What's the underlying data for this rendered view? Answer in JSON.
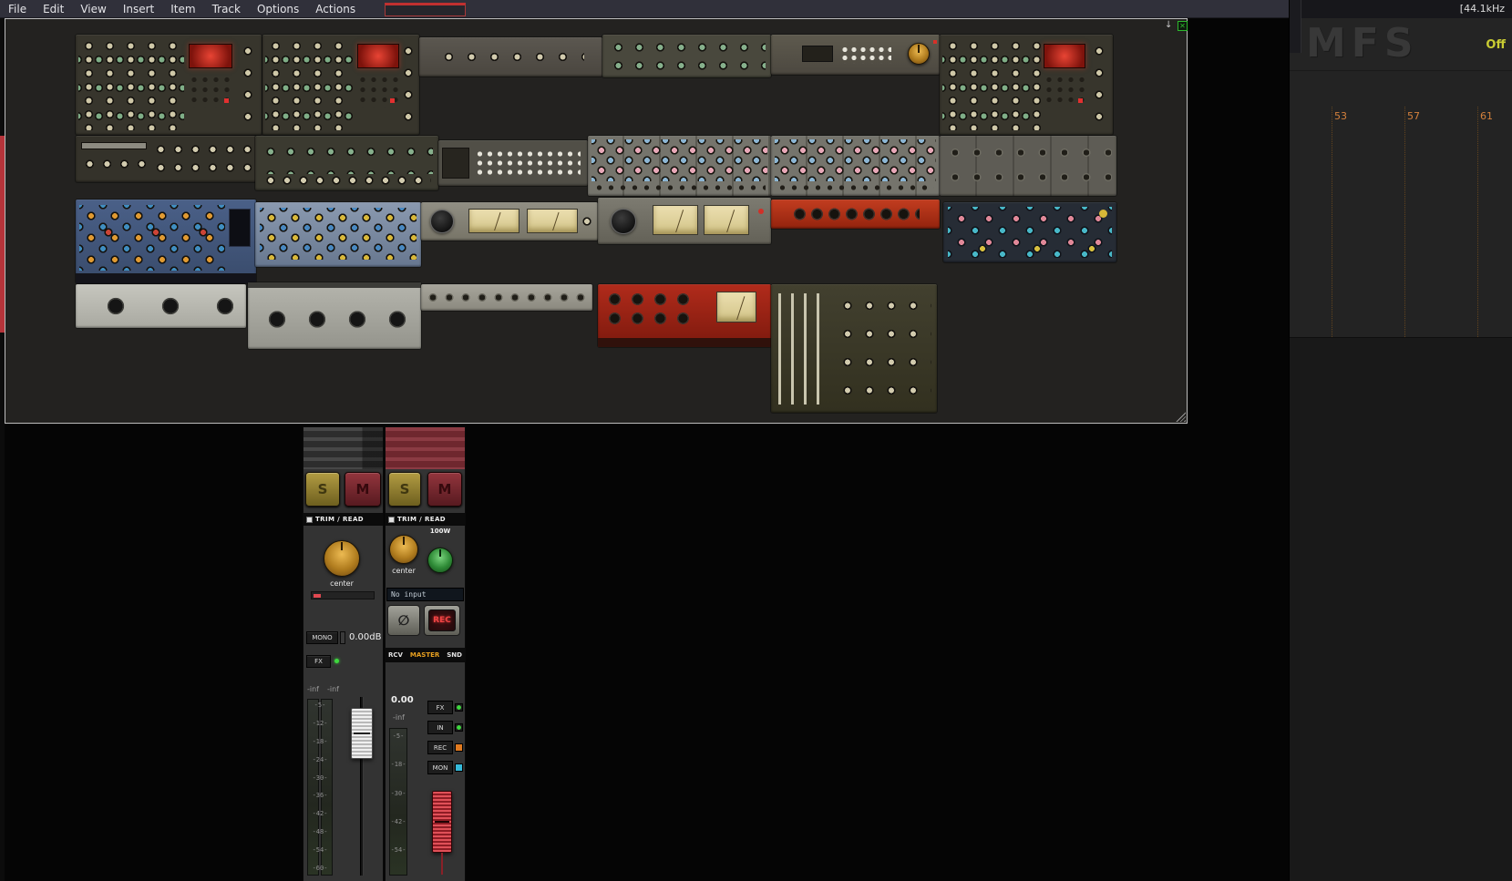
{
  "menu": {
    "items": [
      "File",
      "Edit",
      "View",
      "Insert",
      "Item",
      "Track",
      "Options",
      "Actions"
    ]
  },
  "titlebar": {
    "sample_rate": "[44.1kHz"
  },
  "fx_window": {
    "pin_glyph": "↓",
    "close_glyph": "✕"
  },
  "right_panel": {
    "watermark": "MFS",
    "monitor_off": "Off",
    "ruler_marks": [
      "53",
      "57",
      "61"
    ]
  },
  "mixer": {
    "track1": {
      "solo": "S",
      "mute": "M",
      "automation": "TRIM / READ",
      "pan": "center",
      "mono": "MONO",
      "volume_db": "0.00dB",
      "fx": "FX",
      "peak_left": "-inf",
      "peak_right": "-inf",
      "scale": [
        "-5-",
        "-12-",
        "-18-",
        "-24-",
        "-30-",
        "-36-",
        "-42-",
        "-48-",
        "-54-",
        "-60-"
      ]
    },
    "track2": {
      "solo": "S",
      "mute": "M",
      "automation": "TRIM / READ",
      "pan": "center",
      "watts": "100W",
      "input": "No input",
      "phase": "∅",
      "record": "REC",
      "tabs": [
        "RCV",
        "MASTER",
        "SND"
      ],
      "fader_value": "0.00",
      "peak": "-inf",
      "scale": [
        "-5-",
        "-18-",
        "-30-",
        "-42-",
        "-54-"
      ],
      "buttons": [
        "FX",
        "IN",
        "REC",
        "MON"
      ]
    }
  },
  "accents": {
    "ruler_orange": "#d4813c",
    "off_yellow": "#c9cc33",
    "rec_led_orange": "#e07a20",
    "mon_led_cyan": "#35b9d9",
    "solo_yellow": "#b29c42",
    "mute_red": "#93353d",
    "master_tab_orange": "#e8a020",
    "record_red": "#ef4444"
  }
}
